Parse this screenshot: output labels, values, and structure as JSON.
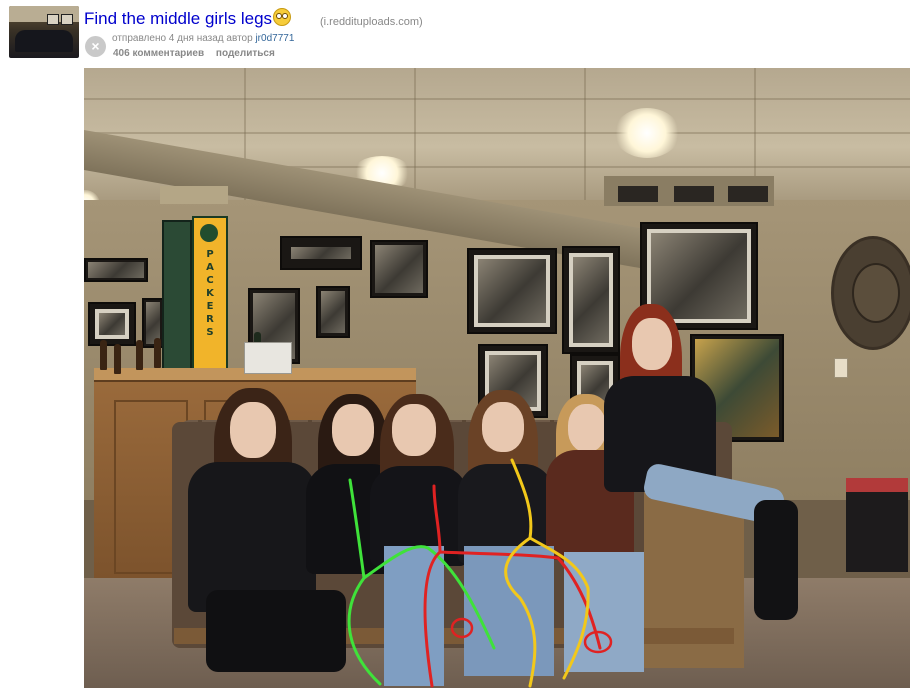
{
  "post": {
    "title": "Find the middle girls legs",
    "title_emoji": "flushed-face-emoji",
    "domain": "(i.reddituploads.com)",
    "tagline_prefix": "отправлено 4 дня назад автор",
    "author": "jr0d7771",
    "comments": "406 комментариев",
    "share": "поделиться",
    "close_icon": "×"
  },
  "photo": {
    "banner_text": "PACKERS",
    "annotation_colors": {
      "green": "#3fe23a",
      "red": "#e02222",
      "yellow": "#f2c81a"
    }
  }
}
